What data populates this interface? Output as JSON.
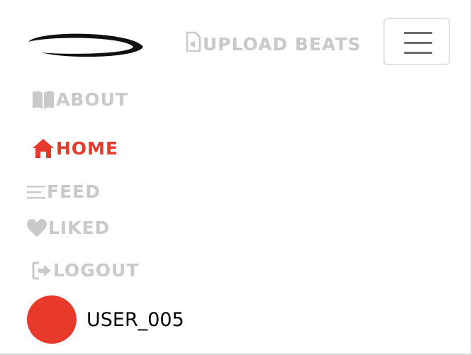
{
  "header": {
    "upload_label": "UPLOAD BEATS"
  },
  "nav": {
    "about": "ABOUT",
    "home": "HOME",
    "feed": "FEED",
    "liked": "LIKED",
    "logout": "LOGOUT"
  },
  "user": {
    "name": "USER_005"
  },
  "colors": {
    "accent": "#e53a2c",
    "inactive": "#c9c9cc",
    "avatar": "#e83a2b"
  }
}
